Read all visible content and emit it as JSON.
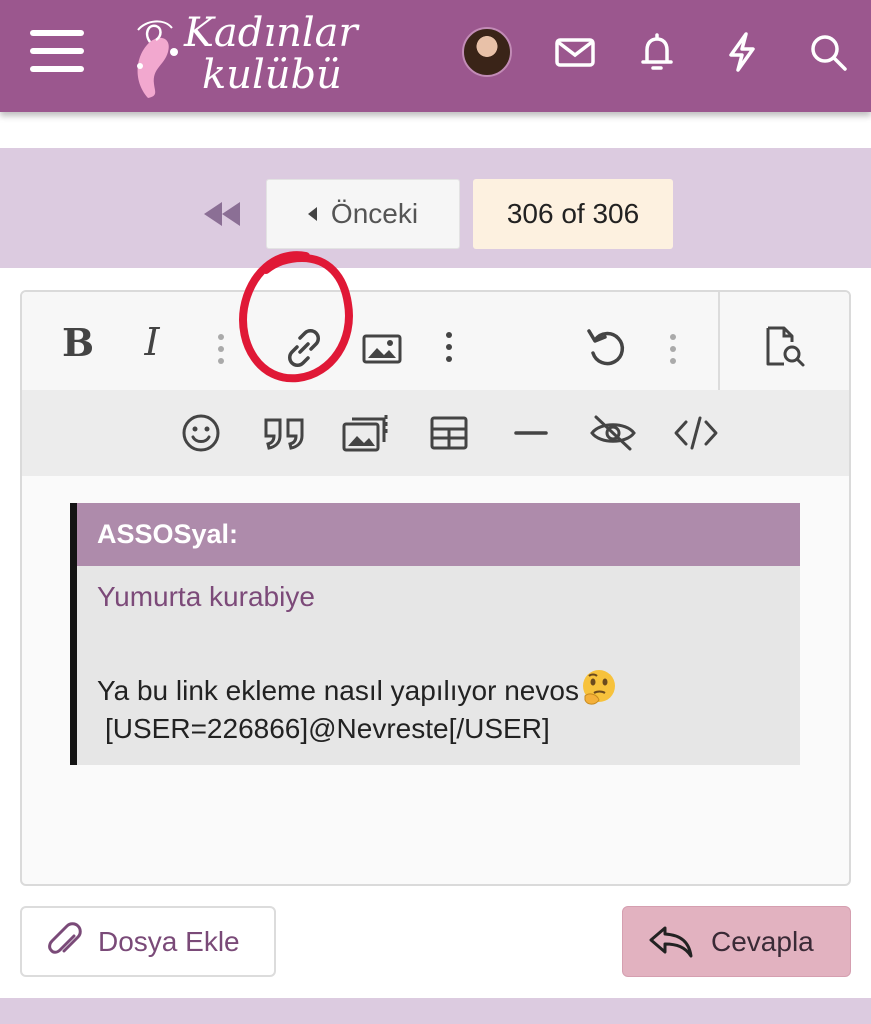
{
  "header": {
    "logo_line1": "Kadınlar",
    "logo_line2": "kulübü",
    "icons": [
      "menu-icon",
      "avatar",
      "mail-icon",
      "bell-icon",
      "lightning-icon",
      "search-icon"
    ],
    "color": "#9b578e"
  },
  "pagination": {
    "prev_label": "Önceki",
    "page_status": "306 of 306"
  },
  "editor": {
    "toolbar1": [
      "bold",
      "italic",
      "more-options",
      "link",
      "image",
      "more-options",
      "undo",
      "more-options",
      "preview"
    ],
    "toolbar2": [
      "smilies",
      "quote",
      "media-gallery",
      "table",
      "horizontal-line",
      "spoiler",
      "code"
    ],
    "bold_label": "B",
    "italic_label": "I",
    "annotation_color": "#e01836",
    "quote": {
      "author": "ASSOSyal:",
      "text": "Yumurta kurabiye"
    },
    "message_line1": "Ya bu link ekleme nasıl yapılıyor nevos",
    "message_emoji": "thinking-face-emoji",
    "message_line2": "[USER=226866]@Nevreste[/USER]"
  },
  "actions": {
    "attach_label": "Dosya Ekle",
    "reply_label": "Cevapla"
  }
}
